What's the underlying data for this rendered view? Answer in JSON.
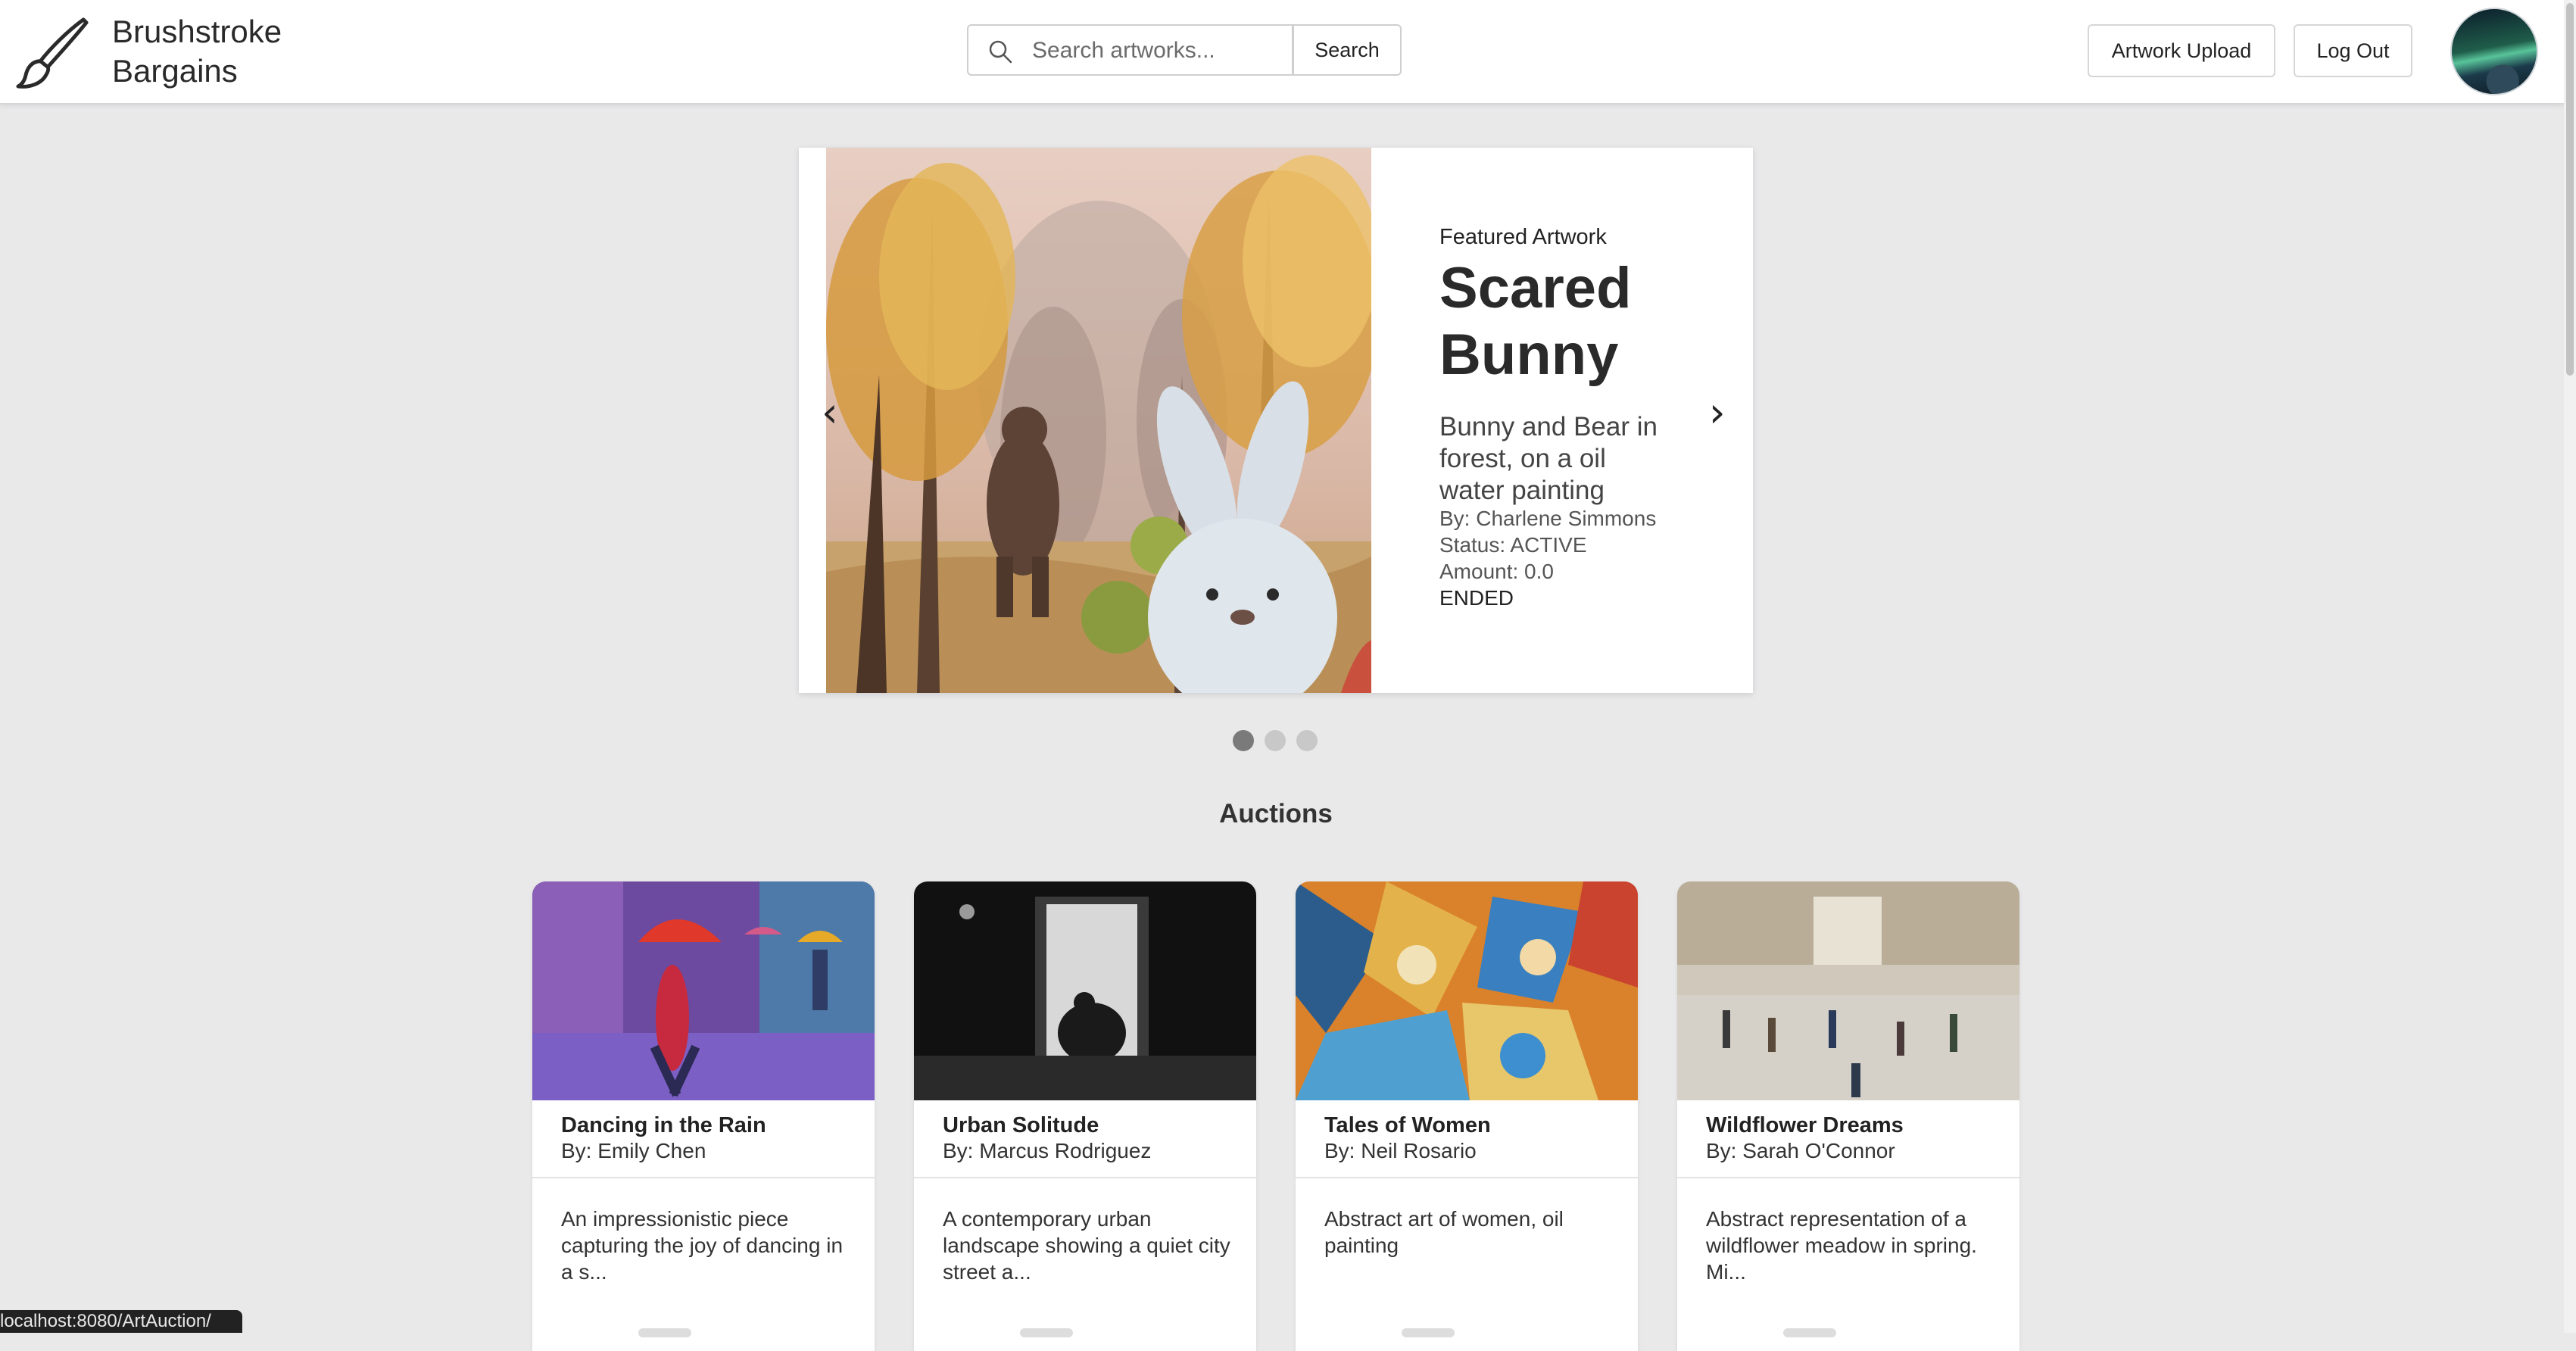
{
  "header": {
    "brand_line1": "Brushstroke",
    "brand_line2": "Bargains",
    "search_placeholder": "Search artworks...",
    "search_button": "Search",
    "upload_button": "Artwork Upload",
    "logout_button": "Log Out"
  },
  "featured": {
    "kicker": "Featured Artwork",
    "title": "Scared Bunny",
    "description": "Bunny and Bear in forest, on a oil water painting",
    "artist": "By: Charlene Simmons",
    "status": "Status: ACTIVE",
    "amount": "Amount: 0.0",
    "state": "ENDED",
    "prev_arrow": "‹",
    "next_arrow": "›",
    "slide_count": 3,
    "active_slide": 1
  },
  "auctions": {
    "title": "Auctions",
    "cards": [
      {
        "title": "Dancing in the Rain",
        "artist": "By: Emily Chen",
        "description": "An impressionistic piece capturing the joy of dancing in a s..."
      },
      {
        "title": "Urban Solitude",
        "artist": "By: Marcus Rodriguez",
        "description": "A contemporary urban landscape showing a quiet city street a..."
      },
      {
        "title": "Tales of Women",
        "artist": "By: Neil Rosario",
        "description": "Abstract art of women, oil painting"
      },
      {
        "title": "Wildflower Dreams",
        "artist": "By: Sarah O'Connor",
        "description": "Abstract representation of a wildflower meadow in spring. Mi..."
      }
    ]
  },
  "status_bar": {
    "url": "localhost:8080/ArtAuction/"
  },
  "colors": {
    "background": "#e9e9ea",
    "card": "#ffffff",
    "active_dot": "#7a7a7a"
  }
}
